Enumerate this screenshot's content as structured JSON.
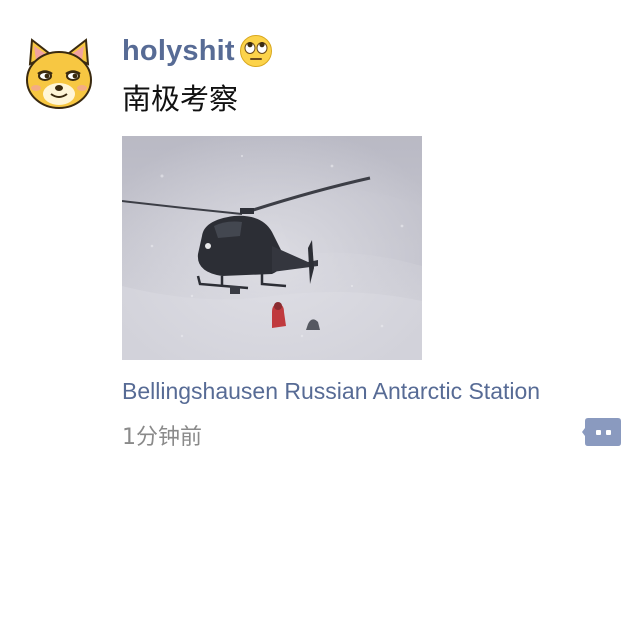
{
  "post": {
    "username": "holyshit",
    "username_emoji": "face-with-rolling-eyes-icon",
    "text": "南极考察",
    "location": "Bellingshausen Russian Antarctic Station",
    "timestamp": "1分钟前",
    "avatar_icon": "cat-avatar-icon",
    "photo_subject": "helicopter-in-snowstorm-photo",
    "comment_icon": "comment-dots-icon"
  },
  "colors": {
    "link_blue": "#576b95",
    "text_dark": "#111111",
    "timestamp_gray": "#8a8a8a",
    "comment_button_bg": "#8a9abf"
  }
}
